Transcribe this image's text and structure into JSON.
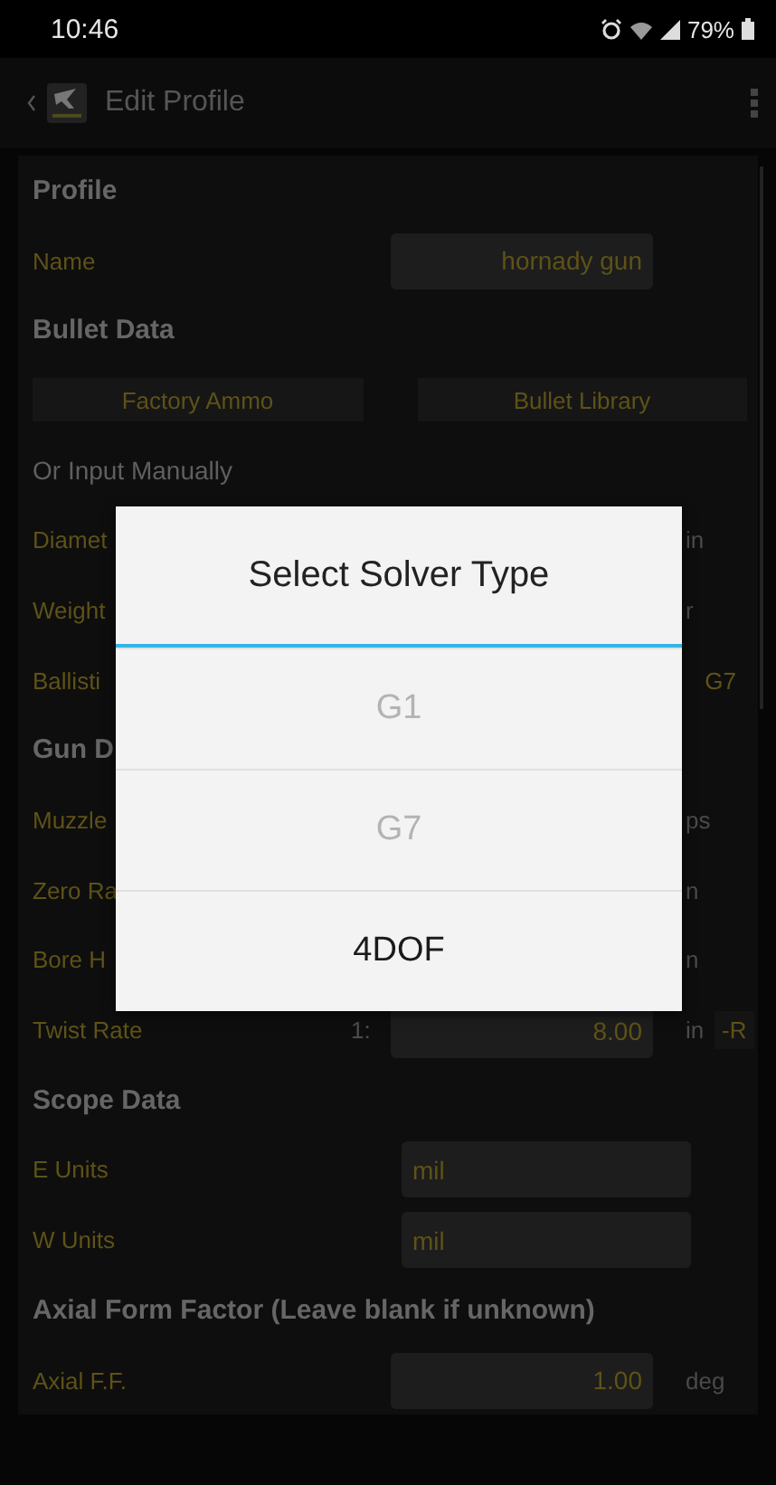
{
  "status_bar": {
    "time": "10:46",
    "battery": "79%"
  },
  "app_bar": {
    "title": "Edit Profile"
  },
  "rows": [
    {
      "kind": "header",
      "label": "Profile"
    },
    {
      "kind": "field",
      "label": "Name",
      "value": "hornady gun"
    },
    {
      "kind": "header",
      "label": "Bullet Data"
    },
    {
      "kind": "buttons",
      "buttons": [
        "Factory Ammo",
        "Bullet Library"
      ]
    },
    {
      "kind": "subheader",
      "label": "Or Input Manually"
    },
    {
      "kind": "field",
      "label": "Diamet",
      "unit": "in"
    },
    {
      "kind": "field",
      "label": "Weight",
      "unit": "r"
    },
    {
      "kind": "select",
      "label": "Ballisti",
      "value": "G7"
    },
    {
      "kind": "header",
      "label": "Gun D"
    },
    {
      "kind": "field",
      "label": "Muzzle",
      "unit": "ps"
    },
    {
      "kind": "field",
      "label": "Zero Ra",
      "unit": "n"
    },
    {
      "kind": "field",
      "label": "Bore H",
      "unit": "n"
    },
    {
      "kind": "twist",
      "label": "Twist Rate",
      "prefix": "1:",
      "value": "8.00",
      "unit": "in",
      "direction": "-R"
    },
    {
      "kind": "header",
      "label": "Scope Data"
    },
    {
      "kind": "unitfield",
      "label": "E Units",
      "value": "mil"
    },
    {
      "kind": "unitfield",
      "label": "W Units",
      "value": "mil"
    },
    {
      "kind": "header",
      "label": "Axial Form Factor (Leave blank if unknown)"
    },
    {
      "kind": "field",
      "label": "Axial F.F.",
      "value": "1.00",
      "unit": "deg"
    }
  ],
  "dialog": {
    "title": "Select Solver Type",
    "options": [
      {
        "label": "G1",
        "disabled": true
      },
      {
        "label": "G7",
        "disabled": true
      },
      {
        "label": "4DOF",
        "disabled": false
      }
    ]
  }
}
